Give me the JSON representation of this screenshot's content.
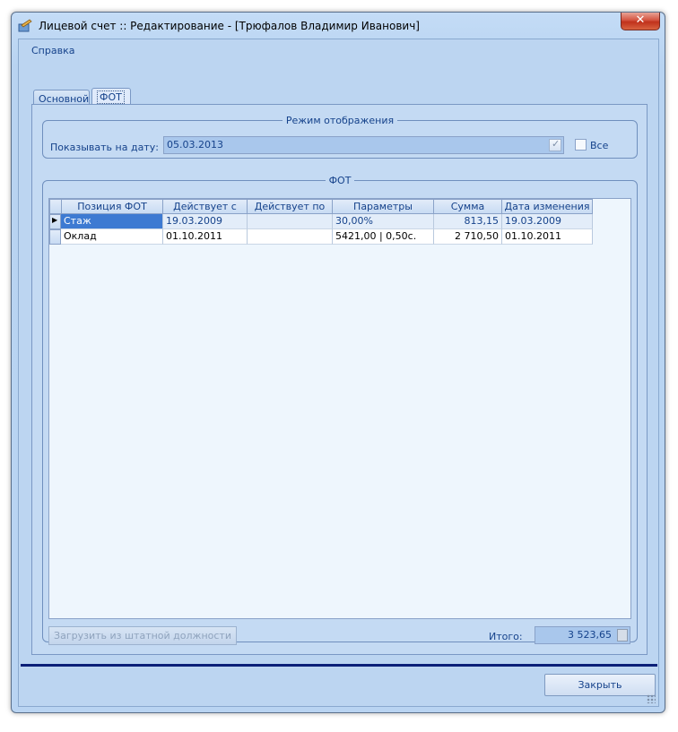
{
  "window": {
    "title": "Лицевой счет :: Редактирование - [Трюфалов Владимир Иванович]",
    "close_label": "✕"
  },
  "menu": {
    "help": "Справка"
  },
  "tabs": [
    {
      "label": "Основной"
    },
    {
      "label": "ФОТ"
    }
  ],
  "mode_group": {
    "legend": "Режим отображения",
    "date_label": "Показывать на дату:",
    "date_value": "05.03.2013",
    "all_label": "Все"
  },
  "fot_group": {
    "legend": "ФОТ",
    "columns": [
      "Позиция ФОТ",
      "Действует с",
      "Действует по",
      "Параметры",
      "Сумма",
      "Дата изменения"
    ],
    "rows": [
      {
        "position": "Стаж",
        "from": "19.03.2009",
        "to": "",
        "params": "30,00%",
        "sum": "813,15",
        "changed": "19.03.2009"
      },
      {
        "position": "Оклад",
        "from": "01.10.2011",
        "to": "",
        "params": "5421,00 | 0,50с.",
        "sum": "2 710,50",
        "changed": "01.10.2011"
      }
    ],
    "load_button": "Загрузить из штатной должности",
    "total_label": "Итого:",
    "total_value": "3 523,65"
  },
  "footer": {
    "close_button": "Закрыть"
  }
}
